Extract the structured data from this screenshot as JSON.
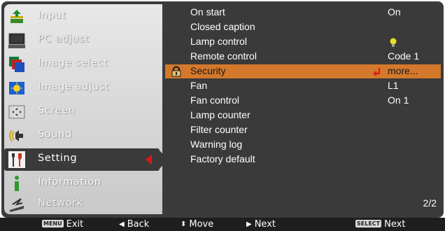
{
  "menu": {
    "items": [
      {
        "label": "Input",
        "icon": "input-icon"
      },
      {
        "label": "PC adjust",
        "icon": "pc-adjust-icon"
      },
      {
        "label": "Image select",
        "icon": "image-select-icon"
      },
      {
        "label": "Image adjust",
        "icon": "image-adjust-icon"
      },
      {
        "label": "Screen",
        "icon": "screen-icon"
      },
      {
        "label": "Sound",
        "icon": "sound-icon"
      },
      {
        "label": "Setting",
        "icon": "setting-icon",
        "active": true
      },
      {
        "label": "Information",
        "icon": "information-icon"
      },
      {
        "label": "Network",
        "icon": "network-icon"
      }
    ]
  },
  "settings": {
    "rows": [
      {
        "label": "On start",
        "value": "On"
      },
      {
        "label": "Closed caption",
        "value": ""
      },
      {
        "label": "Lamp control",
        "value": "",
        "value_icon": "lamp-mode-icon"
      },
      {
        "label": "Remote control",
        "value": "Code 1"
      },
      {
        "label": "Security",
        "value": "more...",
        "highlighted": true,
        "icon": "lock-icon",
        "value_icon": "enter-arrow-icon"
      },
      {
        "label": "Fan",
        "value": "L1"
      },
      {
        "label": "Fan control",
        "value": "On 1"
      },
      {
        "label": "Lamp counter",
        "value": ""
      },
      {
        "label": "Filter counter",
        "value": ""
      },
      {
        "label": "Warning log",
        "value": ""
      },
      {
        "label": "Factory default",
        "value": ""
      }
    ],
    "page_indicator": "2/2"
  },
  "footer": {
    "exit": {
      "key": "MENU",
      "label": "Exit"
    },
    "back": "Back",
    "move": "Move",
    "next": "Next",
    "select_next": {
      "key": "SELECT",
      "label": "Next"
    }
  },
  "colors": {
    "highlight": "#d4782c",
    "panel_dark": "#3a3a3a",
    "selection_arrow": "#e4141b"
  }
}
